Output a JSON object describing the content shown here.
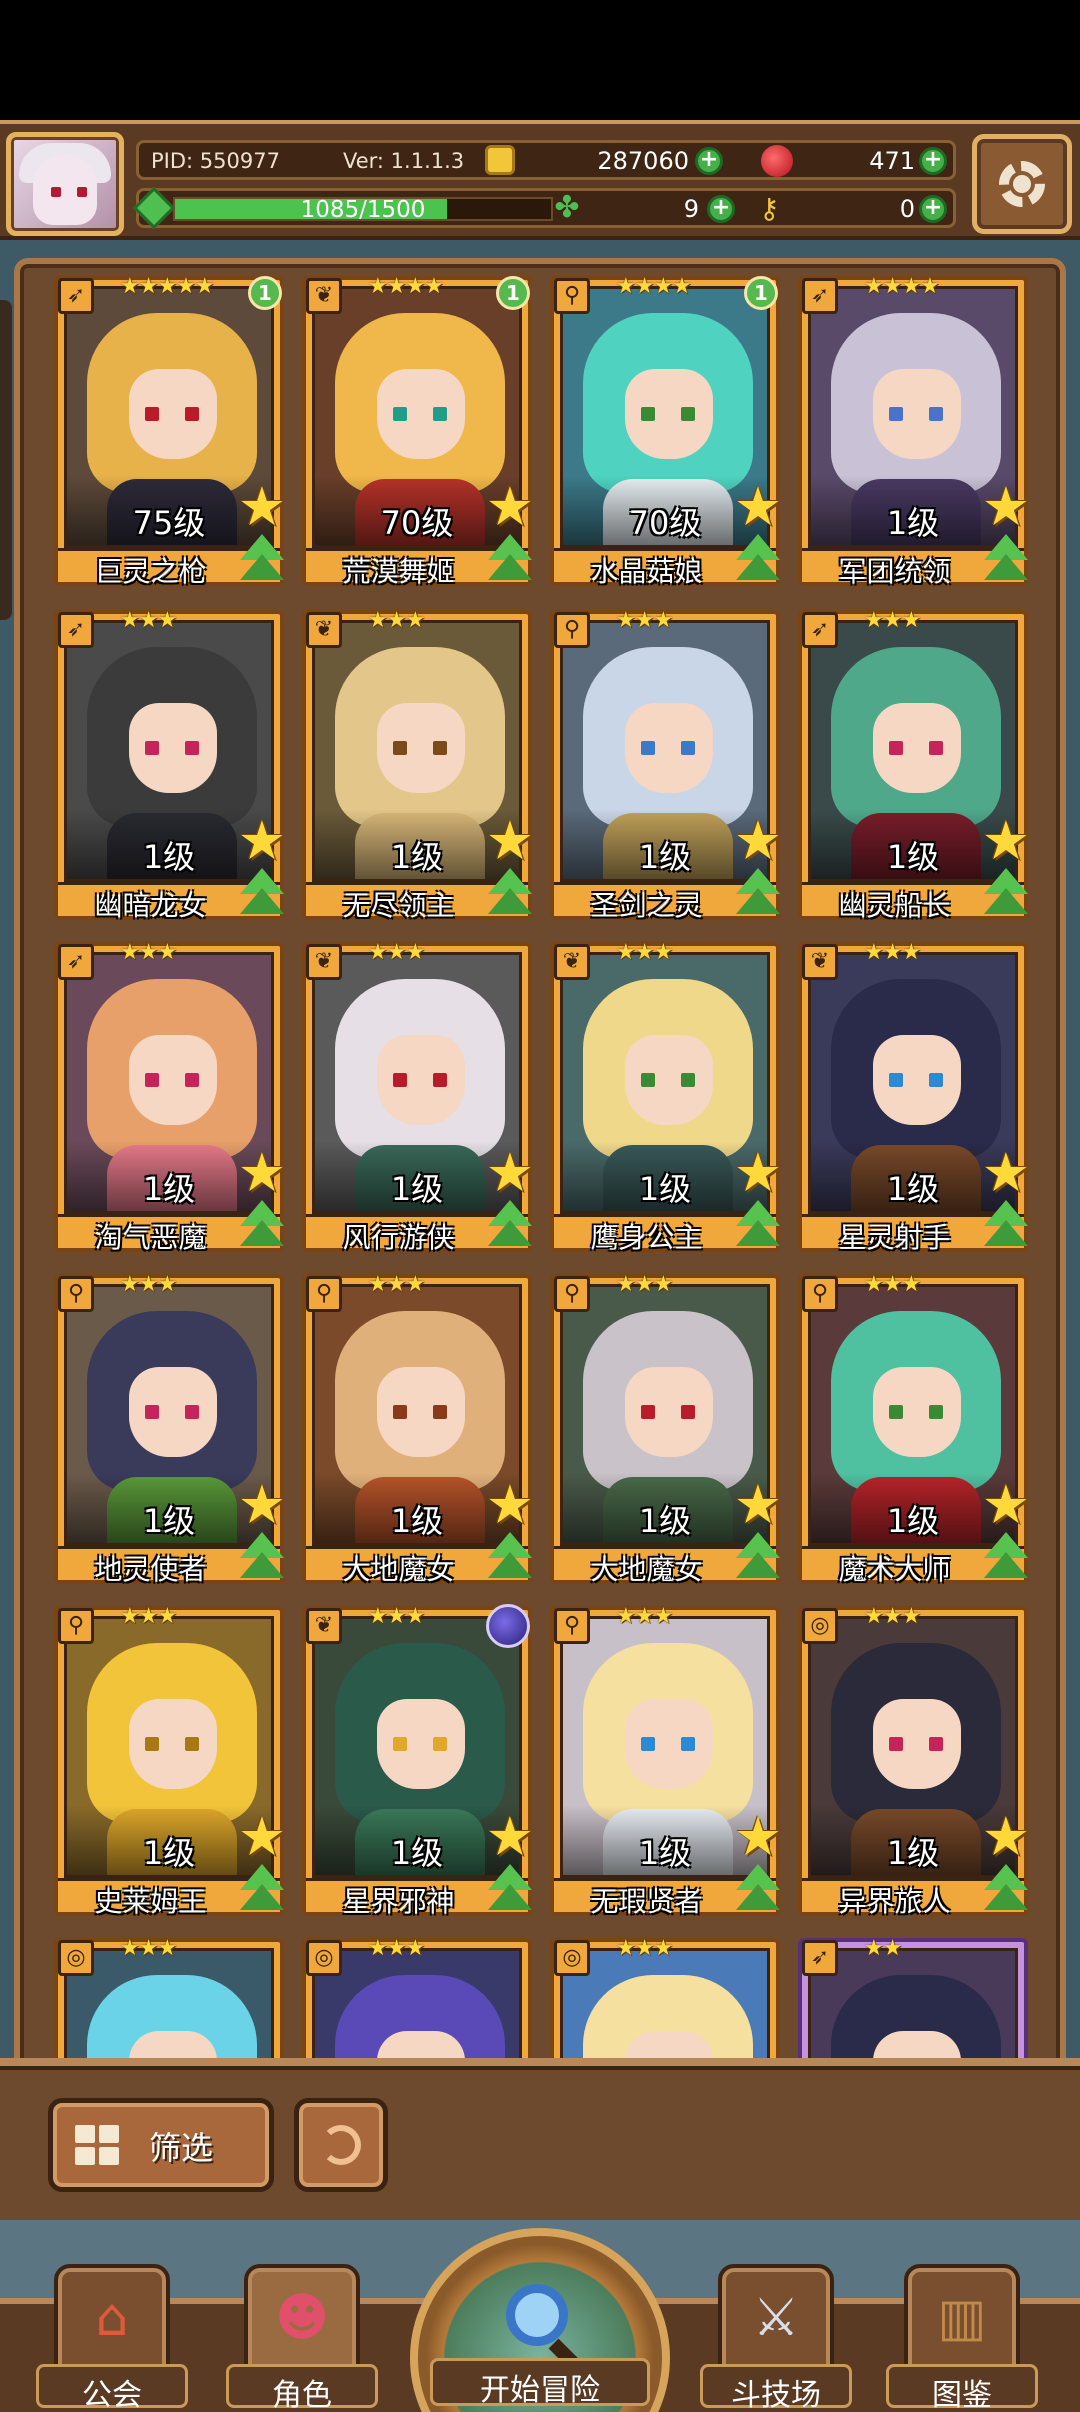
{
  "player": {
    "pid": "PID: 550977",
    "version": "Ver: 1.1.1.3",
    "gold": "287060",
    "gems": "471",
    "exp": "1085/1500",
    "exp_fraction": 0.723,
    "clovers": "9",
    "keys": "0"
  },
  "icons": {
    "plus": "+",
    "clover": "✤",
    "key": "⚷",
    "class_spear": "➶",
    "class_leaf": "❦",
    "class_wand": "⚲",
    "class_orb": "◎",
    "star": "★",
    "big_star": "★"
  },
  "colors": {
    "accent_gold": "#f0a83c",
    "level_up_green": "#58c24e",
    "panel_brown": "#6d4a2d",
    "rarity_purple": "#c592e0"
  },
  "heroes": [
    {
      "name": "巨灵之枪",
      "level": "75级",
      "stars": "★★★★★",
      "badge": "1",
      "class_icon": "➶",
      "hair": "#e7b24a",
      "eyes": "#b81c2a",
      "body": "#2e2b3a",
      "bg": "#5e4a3a"
    },
    {
      "name": "荒漠舞姬",
      "level": "70级",
      "stars": "★★★★",
      "badge": "1",
      "class_icon": "❦",
      "hair": "#f0b84a",
      "eyes": "#1f9c8a",
      "body": "#b8332a",
      "bg": "#6a3f2a"
    },
    {
      "name": "水晶菇娘",
      "level": "70级",
      "stars": "★★★★",
      "badge": "1",
      "class_icon": "⚲",
      "hair": "#4fd3c0",
      "eyes": "#3a8a34",
      "body": "#e8f0f4",
      "bg": "#3c7a8a"
    },
    {
      "name": "军团统领",
      "level": "1级",
      "stars": "★★★★",
      "badge": "",
      "class_icon": "➶",
      "hair": "#c9c2d6",
      "eyes": "#4a72c8",
      "body": "#4a3a64",
      "bg": "#5a4a6a"
    },
    {
      "name": "幽暗龙女",
      "level": "1级",
      "stars": "★★★",
      "badge": "",
      "class_icon": "➶",
      "hair": "#3b3b3b",
      "eyes": "#c4245a",
      "body": "#2a2a32",
      "bg": "#4a4a4a"
    },
    {
      "name": "无尽领主",
      "level": "1级",
      "stars": "★★★",
      "badge": "",
      "class_icon": "❦",
      "hair": "#e3c78a",
      "eyes": "#7a4a1a",
      "body": "#d9b878",
      "bg": "#6a5a3a"
    },
    {
      "name": "圣剑之灵",
      "level": "1级",
      "stars": "★★★",
      "badge": "",
      "class_icon": "⚲",
      "hair": "#c9d6e8",
      "eyes": "#3a7ac8",
      "body": "#c2a25a",
      "bg": "#5a6a7a"
    },
    {
      "name": "幽灵船长",
      "level": "1级",
      "stars": "★★★",
      "badge": "",
      "class_icon": "➶",
      "hair": "#4fa88a",
      "eyes": "#c4245a",
      "body": "#7a1e2a",
      "bg": "#3a4a4a"
    },
    {
      "name": "淘气恶魔",
      "level": "1级",
      "stars": "★★★",
      "badge": "",
      "class_icon": "➶",
      "hair": "#e8a06a",
      "eyes": "#c4245a",
      "body": "#e87a8a",
      "bg": "#6a4a5a"
    },
    {
      "name": "风行游侠",
      "level": "1级",
      "stars": "★★★",
      "badge": "",
      "class_icon": "❦",
      "hair": "#e6e0e6",
      "eyes": "#b81c2a",
      "body": "#3a6a5a",
      "bg": "#5a5a5a"
    },
    {
      "name": "鹰身公主",
      "level": "1级",
      "stars": "★★★",
      "badge": "",
      "class_icon": "❦",
      "hair": "#f0d88a",
      "eyes": "#3a8a34",
      "body": "#3a5a5a",
      "bg": "#4a6a6a"
    },
    {
      "name": "星灵射手",
      "level": "1级",
      "stars": "★★★",
      "badge": "",
      "class_icon": "❦",
      "hair": "#2a2a4a",
      "eyes": "#2a8ad3",
      "body": "#7a4a2a",
      "bg": "#3a3a5a"
    },
    {
      "name": "地灵使者",
      "level": "1级",
      "stars": "★★★",
      "badge": "",
      "class_icon": "⚲",
      "hair": "#3a3a5a",
      "eyes": "#c4245a",
      "body": "#5a9a3a",
      "bg": "#6a5a4a"
    },
    {
      "name": "大地魔女",
      "level": "1级",
      "stars": "★★★",
      "badge": "",
      "class_icon": "⚲",
      "hair": "#e0b07a",
      "eyes": "#8a3a1a",
      "body": "#b8542a",
      "bg": "#7a4a2a"
    },
    {
      "name": "大地魔女",
      "level": "1级",
      "stars": "★★★",
      "badge": "",
      "class_icon": "⚲",
      "hair": "#c9c2c8",
      "eyes": "#b81c2a",
      "body": "#4a6a4a",
      "bg": "#4a5a4a"
    },
    {
      "name": "魔术大师",
      "level": "1级",
      "stars": "★★★",
      "badge": "",
      "class_icon": "⚲",
      "hair": "#4fc0a0",
      "eyes": "#3a8a34",
      "body": "#b8242a",
      "bg": "#5a3a3a"
    },
    {
      "name": "史莱姆王",
      "level": "1级",
      "stars": "★★★",
      "badge": "",
      "class_icon": "⚲",
      "hair": "#f2c43a",
      "eyes": "#a87814",
      "body": "#e0a82a",
      "bg": "#8a6a2a"
    },
    {
      "name": "星界邪神",
      "level": "1级",
      "stars": "★★★",
      "badge": "orb",
      "class_icon": "❦",
      "hair": "#2a5a4a",
      "eyes": "#e0a82a",
      "body": "#3a7a5a",
      "bg": "#3a4a3a"
    },
    {
      "name": "无瑕贤者",
      "level": "1级",
      "stars": "★★★",
      "badge": "",
      "class_icon": "⚲",
      "hair": "#f6e0a0",
      "eyes": "#2a8ad3",
      "body": "#e8eef4",
      "bg": "#c8c0c8"
    },
    {
      "name": "异界旅人",
      "level": "1级",
      "stars": "★★★",
      "badge": "",
      "class_icon": "◎",
      "hair": "#2a2a3a",
      "eyes": "#c4245a",
      "body": "#7a4a2a",
      "bg": "#4a3a3a"
    },
    {
      "name": "",
      "level": "",
      "stars": "★★★",
      "badge": "",
      "class_icon": "◎",
      "hair": "#6ad3e8",
      "eyes": "#2a8ad3",
      "body": "#4a9ab8",
      "bg": "#3a5a6a"
    },
    {
      "name": "",
      "level": "",
      "stars": "★★★",
      "badge": "",
      "class_icon": "◎",
      "hair": "#5a4ab8",
      "eyes": "#e0a82a",
      "body": "#3a2a7a",
      "bg": "#3a3a6a"
    },
    {
      "name": "",
      "level": "",
      "stars": "★★★",
      "badge": "",
      "class_icon": "◎",
      "hair": "#f6e0a0",
      "eyes": "#2a8ad3",
      "body": "#e8eef4",
      "bg": "#4a7ab8"
    },
    {
      "name": "",
      "level": "",
      "stars": "★★",
      "badge": "",
      "class_icon": "➶",
      "hair": "#2a2a4a",
      "eyes": "#5a9a3a",
      "body": "#3a2a5a",
      "bg": "#4a3a5a",
      "rarity": "purple"
    }
  ],
  "controls": {
    "filter_label": "筛选"
  },
  "nav": {
    "guild": "公会",
    "heroes": "角色",
    "adventure": "开始冒险",
    "arena": "斗技场",
    "codex": "图鉴"
  }
}
